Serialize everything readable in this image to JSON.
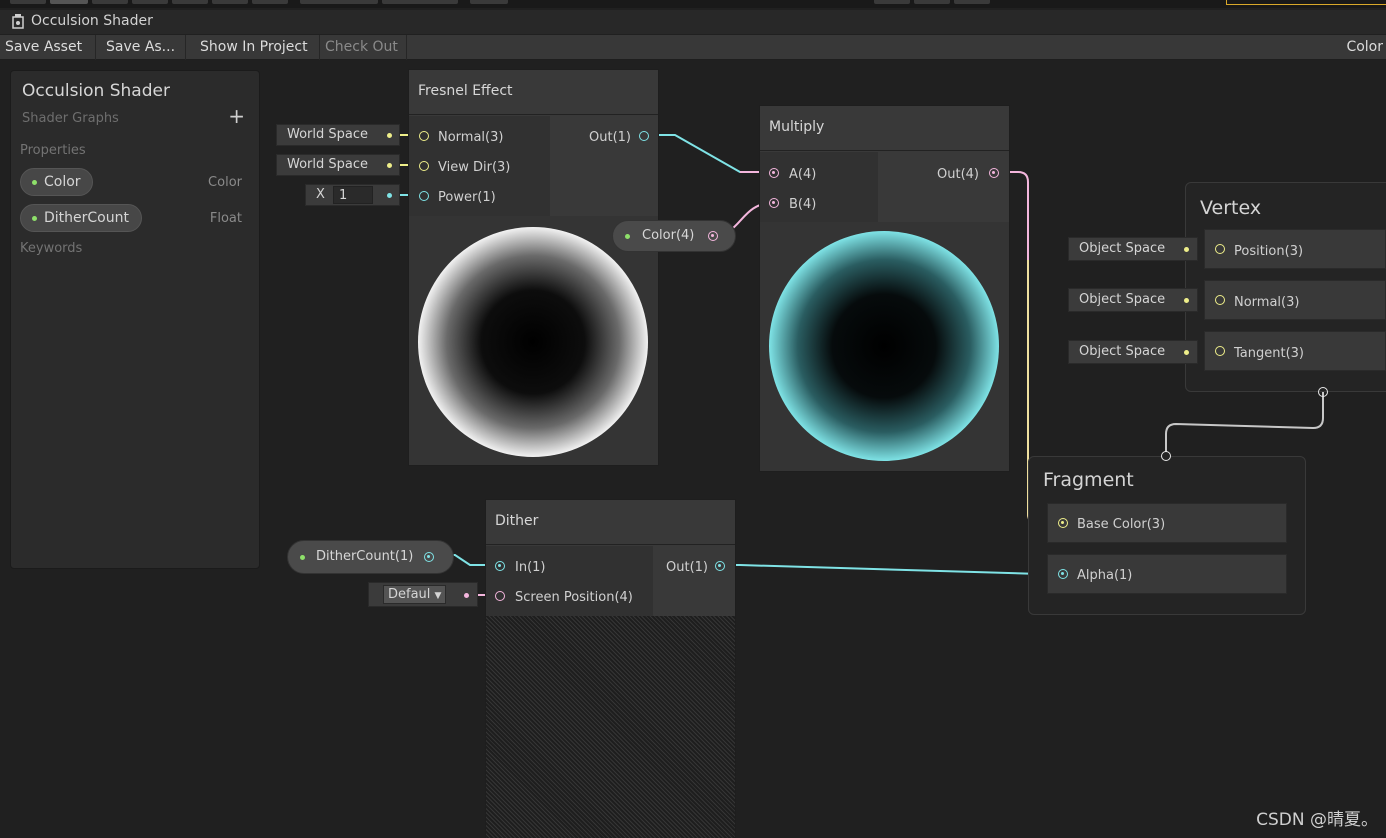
{
  "window": {
    "title": "Occulsion Shader"
  },
  "toolbar": {
    "save_asset": "Save Asset",
    "save_as": "Save As...",
    "show_in_project": "Show In Project",
    "check_out": "Check Out",
    "color_toggle": "Color"
  },
  "blackboard": {
    "title": "Occulsion Shader",
    "subtitle": "Shader Graphs",
    "add_icon": "+",
    "properties_label": "Properties",
    "keywords_label": "Keywords",
    "properties": [
      {
        "name": "Color",
        "type": "Color"
      },
      {
        "name": "DitherCount",
        "type": "Float"
      }
    ]
  },
  "fresnel": {
    "title": "Fresnel Effect",
    "inputs": [
      "Normal(3)",
      "View Dir(3)",
      "Power(1)"
    ],
    "output": "Out(1)",
    "normal_space": "World Space",
    "viewdir_space": "World Space",
    "power_axis": "X",
    "power_value": "1"
  },
  "color_property": {
    "label": "Color(4)"
  },
  "multiply": {
    "title": "Multiply",
    "inputs": [
      "A(4)",
      "B(4)"
    ],
    "output": "Out(4)"
  },
  "vertex": {
    "title": "Vertex",
    "slots": [
      {
        "space": "Object Space",
        "label": "Position(3)"
      },
      {
        "space": "Object Space",
        "label": "Normal(3)"
      },
      {
        "space": "Object Space",
        "label": "Tangent(3)"
      }
    ]
  },
  "fragment": {
    "title": "Fragment",
    "slots": [
      "Base Color(3)",
      "Alpha(1)"
    ]
  },
  "dither": {
    "title": "Dither",
    "inputs": [
      "In(1)",
      "Screen Position(4)"
    ],
    "output": "Out(1)",
    "screen_pos_mode": "Defaul"
  },
  "dithercount_property": {
    "label": "DitherCount(1)"
  },
  "watermark": "CSDN @晴夏。",
  "colors": {
    "vector3": "#eeee8a",
    "vector1": "#7fe3e6",
    "vector4": "#f4b6dd",
    "property_dot": "#8ee06a"
  }
}
